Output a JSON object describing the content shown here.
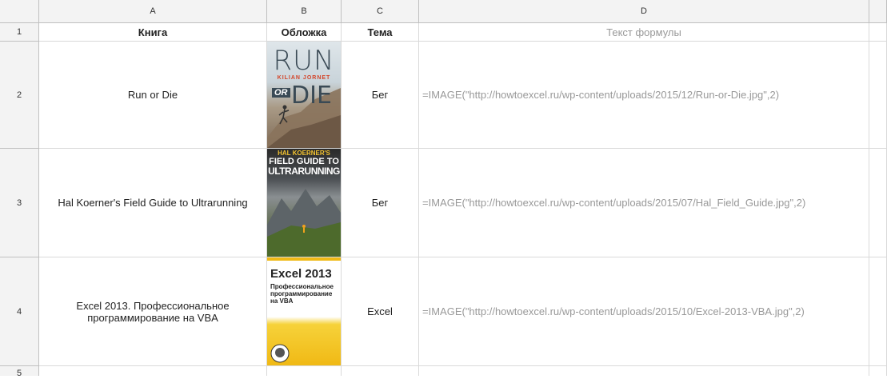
{
  "columns": [
    "A",
    "B",
    "C",
    "D"
  ],
  "rows": [
    "1",
    "2",
    "3",
    "4",
    "5"
  ],
  "header_row": {
    "a": "Книга",
    "b": "Обложка",
    "c": "Тема",
    "d": "Текст формулы"
  },
  "data_rows": [
    {
      "book": "Run or Die",
      "topic": "Бег",
      "formula": "=IMAGE(\"http://howtoexcel.ru/wp-content/uploads/2015/12/Run-or-Die.jpg\",2)",
      "cover": {
        "line1": "RUN",
        "line2": "KILIAN JORNET",
        "line3": "OR",
        "line4": "DIE"
      }
    },
    {
      "book": "Hal Koerner's Field Guide to Ultrarunning",
      "topic": "Бег",
      "formula": "=IMAGE(\"http://howtoexcel.ru/wp-content/uploads/2015/07/Hal_Field_Guide.jpg\",2)",
      "cover": {
        "line1": "HAL KOERNER'S",
        "line2": "FIELD GUIDE TO",
        "line3": "ULTRARUNNING"
      }
    },
    {
      "book": "Excel 2013. Профессиональное программирование на VBA",
      "topic": "Excel",
      "formula": "=IMAGE(\"http://howtoexcel.ru/wp-content/uploads/2015/10/Excel-2013-VBA.jpg\",2)",
      "cover": {
        "line1": "Excel 2013",
        "line2": "Профессиональное программирование на VBA"
      }
    }
  ]
}
